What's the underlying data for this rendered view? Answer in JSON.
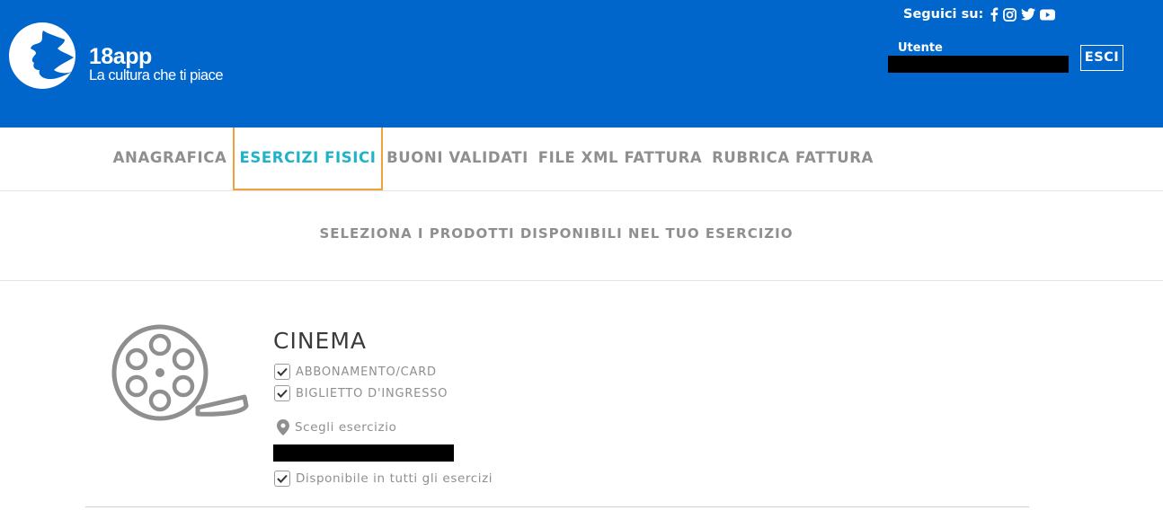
{
  "brand": {
    "name": "18app",
    "tagline": "La cultura che ti piace"
  },
  "header": {
    "social_label": "Seguici su:",
    "social_icons": [
      "facebook-icon",
      "instagram-icon",
      "twitter-icon",
      "youtube-icon"
    ],
    "user_label": "Utente",
    "logout_label": "ESCI"
  },
  "tabs": [
    {
      "label": "ANAGRAFICA",
      "active": false
    },
    {
      "label": "ESERCIZI FISICI",
      "active": true
    },
    {
      "label": "BUONI VALIDATI",
      "active": false
    },
    {
      "label": "FILE XML FATTURA",
      "active": false
    },
    {
      "label": "RUBRICA FATTURA",
      "active": false
    }
  ],
  "section_title": "SELEZIONA I PRODOTTI DISPONIBILI NEL TUO ESERCIZIO",
  "category": {
    "title": "CINEMA",
    "icon": "film-reel-icon",
    "products": [
      {
        "label": "ABBONAMENTO/CARD",
        "checked": true
      },
      {
        "label": "BIGLIETTO D'INGRESSO",
        "checked": true
      }
    ],
    "select_label": "Scegli esercizio",
    "all_label": "Disponibile in tutti gli esercizi",
    "all_checked": true
  },
  "colors": {
    "header_bg": "#0066cc",
    "active_tab_text": "#1fb3c7",
    "active_tab_border": "#f0a23a",
    "muted_text": "#8f8f8f"
  }
}
